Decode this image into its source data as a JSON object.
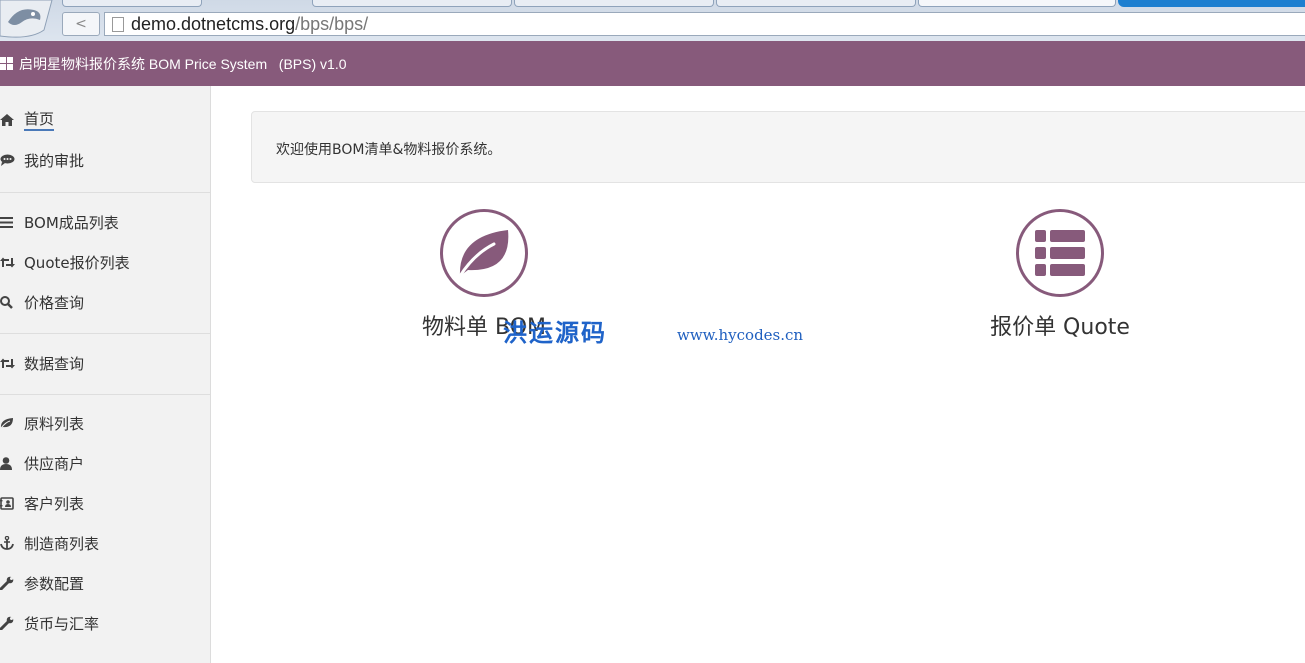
{
  "browser": {
    "url_host": "demo.dotnetcms.org",
    "url_path": "/bps/bps/",
    "back_symbol": "<"
  },
  "app": {
    "title": "启明星物料报价系统 BOM Price System   (BPS) v1.0",
    "accent_color": "#875a7b"
  },
  "sidebar": {
    "items": [
      {
        "label": "首页",
        "icon": "home-icon",
        "current": true
      },
      {
        "label": "我的审批",
        "icon": "comments-icon"
      },
      {
        "label": "BOM成品列表",
        "icon": "list-icon"
      },
      {
        "label": "Quote报价列表",
        "icon": "retweet-icon"
      },
      {
        "label": "价格查询",
        "icon": "search-icon"
      },
      {
        "label": "数据查询",
        "icon": "retweet-icon"
      },
      {
        "label": "原料列表",
        "icon": "leaf-icon"
      },
      {
        "label": "供应商户",
        "icon": "user-icon"
      },
      {
        "label": "客户列表",
        "icon": "contact-card-icon"
      },
      {
        "label": "制造商列表",
        "icon": "anchor-icon"
      },
      {
        "label": "参数配置",
        "icon": "wrench-icon"
      },
      {
        "label": "货币与汇率",
        "icon": "wrench-icon"
      }
    ]
  },
  "main": {
    "welcome": "欢迎使用BOM清单&物料报价系统。",
    "tiles": [
      {
        "label": "物料单 BOM",
        "icon": "leaf-icon"
      },
      {
        "label": "报价单 Quote",
        "icon": "th-list-icon"
      }
    ]
  },
  "watermark": {
    "text": "洪运源码",
    "url": "www.hycodes.cn"
  }
}
